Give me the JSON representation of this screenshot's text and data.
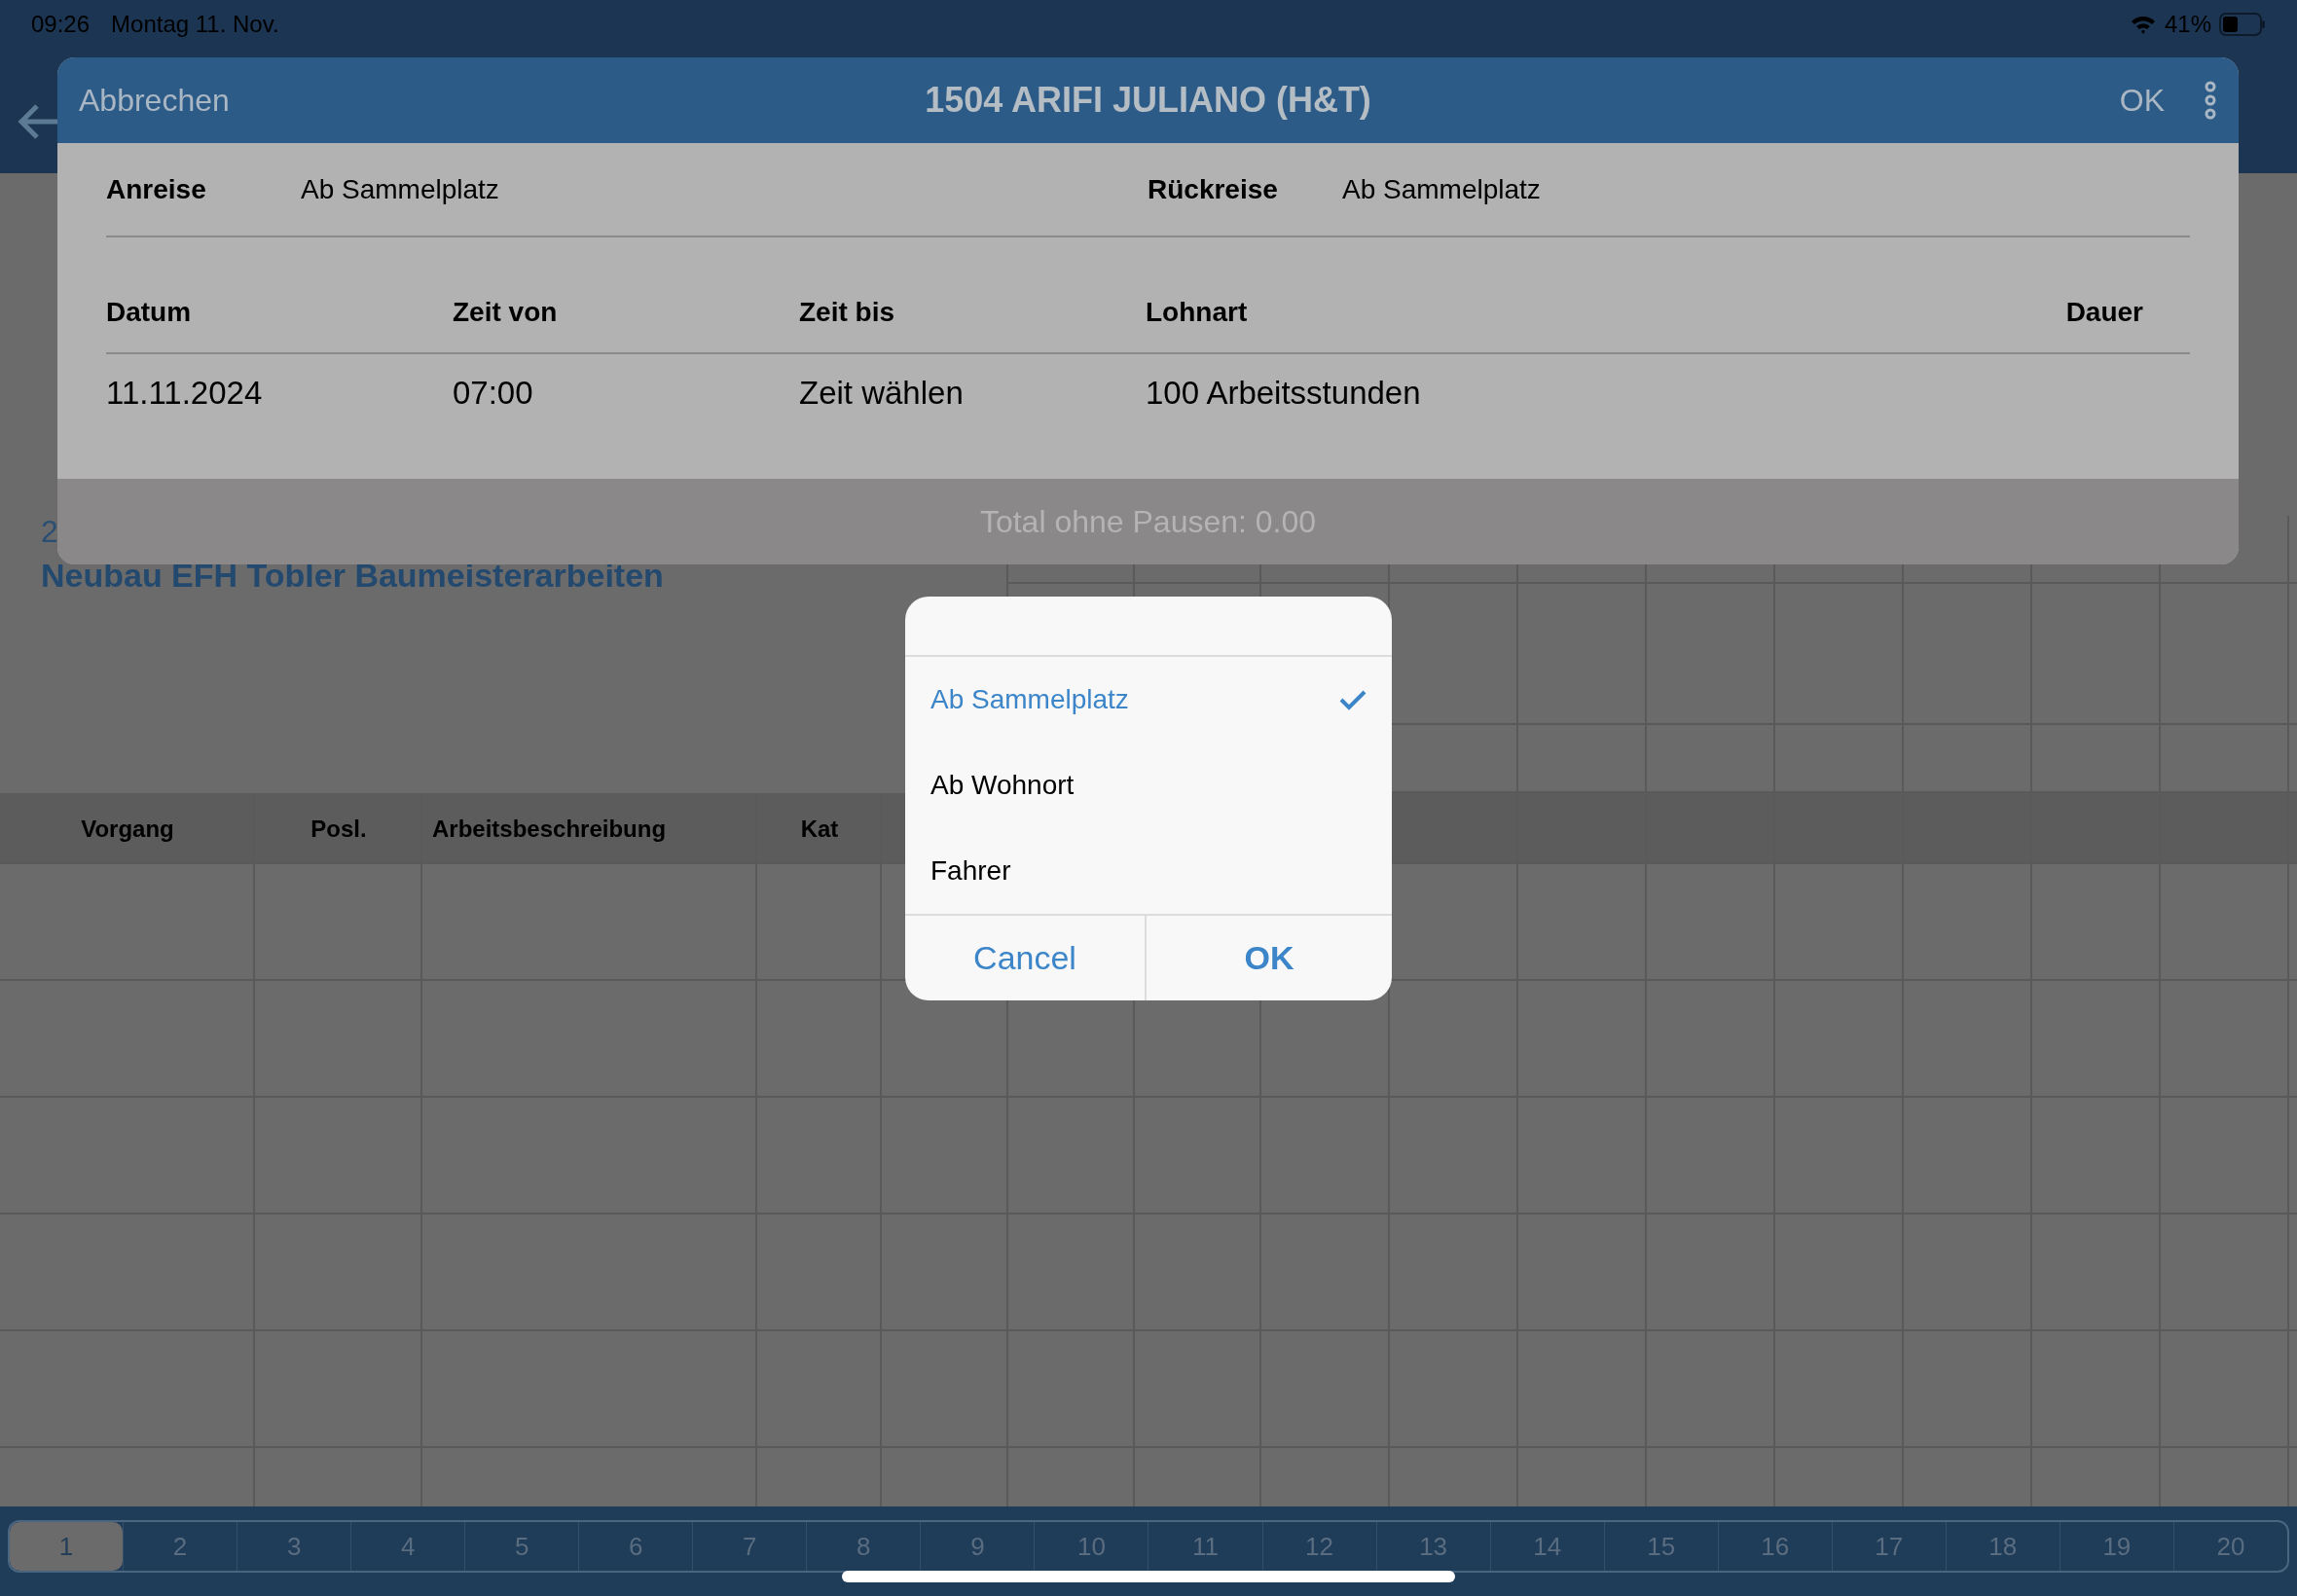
{
  "status_bar": {
    "time": "09:26",
    "date": "Montag 11. Nov.",
    "battery": "41%"
  },
  "background": {
    "project_number": "2",
    "project_title": "Neubau EFH Tobler Baumeisterarbeiten",
    "columns": [
      "Vorgang",
      "Posl.",
      "Arbeitsbeschreibung",
      "Kat"
    ],
    "pages": [
      {
        "label": "1",
        "selected": true
      },
      {
        "label": "2",
        "selected": false
      },
      {
        "label": "3",
        "selected": false
      },
      {
        "label": "4",
        "selected": false
      },
      {
        "label": "5",
        "selected": false
      },
      {
        "label": "6",
        "selected": false
      },
      {
        "label": "7",
        "selected": false
      },
      {
        "label": "8",
        "selected": false
      },
      {
        "label": "9",
        "selected": false
      },
      {
        "label": "10",
        "selected": false
      },
      {
        "label": "11",
        "selected": false
      },
      {
        "label": "12",
        "selected": false
      },
      {
        "label": "13",
        "selected": false
      },
      {
        "label": "14",
        "selected": false
      },
      {
        "label": "15",
        "selected": false
      },
      {
        "label": "16",
        "selected": false
      },
      {
        "label": "17",
        "selected": false
      },
      {
        "label": "18",
        "selected": false
      },
      {
        "label": "19",
        "selected": false
      },
      {
        "label": "20",
        "selected": false
      }
    ]
  },
  "dialog": {
    "cancel": "Abbrechen",
    "title": "1504 ARIFI JULIANO (H&T)",
    "ok": "OK",
    "travel": [
      {
        "label": "Anreise",
        "value": "Ab Sammelplatz"
      },
      {
        "label": "Rückreise",
        "value": "Ab Sammelplatz"
      }
    ],
    "columns": [
      "Datum",
      "Zeit von",
      "Zeit bis",
      "Lohnart",
      "Dauer"
    ],
    "rows": [
      [
        "11.11.2024",
        "07:00",
        "Zeit wählen",
        "100 Arbeitsstunden"
      ]
    ],
    "total": "Total ohne Pausen: 0.00"
  },
  "picker": {
    "options": [
      {
        "label": "Ab Sammelplatz",
        "selected": true
      },
      {
        "label": "Ab Wohnort",
        "selected": false
      },
      {
        "label": "Fahrer",
        "selected": false
      }
    ],
    "cancel": "Cancel",
    "ok": "OK"
  }
}
